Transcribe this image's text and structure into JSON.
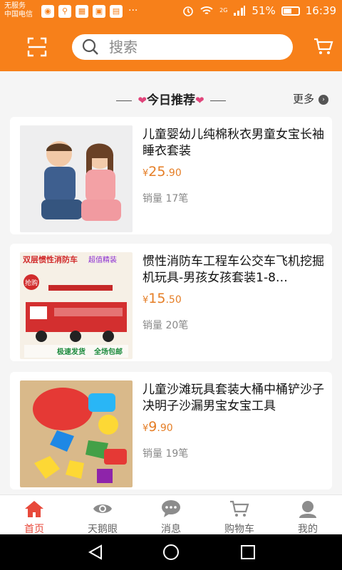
{
  "status_bar": {
    "carrier_line1": "无服务",
    "carrier_line2": "中国电信",
    "signal_label": "2G",
    "battery": "51%",
    "time": "16:39",
    "more_dots": "···"
  },
  "header": {
    "search_placeholder": "搜索",
    "icons": [
      "scan-icon",
      "search-icon",
      "cart-icon"
    ]
  },
  "section": {
    "title": "今日推荐",
    "more_label": "更多"
  },
  "products": [
    {
      "title": "儿童婴幼儿纯棉秋衣男童女宝长袖睡衣套装",
      "currency": "¥",
      "price_int": "25",
      "price_dec": ".90",
      "sales": "销量 17笔"
    },
    {
      "title": "惯性消防车工程车公交车飞机挖掘机玩具-男孩女孩套装1-8…",
      "currency": "¥",
      "price_int": "15",
      "price_dec": ".50",
      "sales": "销量 20笔",
      "image_text": [
        "双层惯性消防车",
        "超值精装",
        "抢购",
        "极速发货",
        "全场包邮"
      ]
    },
    {
      "title": "儿童沙滩玩具套装大桶中桶铲沙子决明子沙漏男宝女宝工具",
      "currency": "¥",
      "price_int": "9",
      "price_dec": ".90",
      "sales": "销量 19笔"
    }
  ],
  "bottom_nav": [
    {
      "label": "首页",
      "icon": "home-icon",
      "active": true
    },
    {
      "label": "天鹅眼",
      "icon": "eye-icon",
      "active": false
    },
    {
      "label": "消息",
      "icon": "message-icon",
      "active": false
    },
    {
      "label": "购物车",
      "icon": "cart-icon",
      "active": false
    },
    {
      "label": "我的",
      "icon": "profile-icon",
      "active": false
    }
  ],
  "colors": {
    "brand_orange": "#f7801a",
    "price_orange": "#e57e26",
    "active_red": "#e8493b"
  }
}
